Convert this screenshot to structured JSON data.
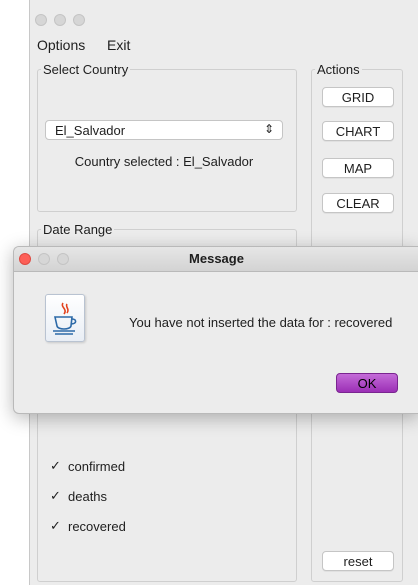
{
  "menu": {
    "options": "Options",
    "exit": "Exit"
  },
  "country_group": {
    "legend": "Select Country",
    "combo_value": "El_Salvador",
    "selected_label": "Country selected : El_Salvador"
  },
  "actions_group": {
    "legend": "Actions",
    "grid": "GRID",
    "chart": "CHART",
    "map": "MAP",
    "clear": "CLEAR",
    "reset": "reset"
  },
  "date_group": {
    "legend": "Date Range"
  },
  "checks": [
    {
      "label": "confirmed",
      "checked": true
    },
    {
      "label": "deaths",
      "checked": true
    },
    {
      "label": "recovered",
      "checked": true
    }
  ],
  "dialog": {
    "title": "Message",
    "message": "You have not inserted the data for : recovered",
    "ok": "OK"
  },
  "colors": {
    "ok_button": "#a23cbb",
    "close_light": "#fd5f57",
    "window_bg": "#ececec"
  },
  "icons": {
    "combo": "chevron-up-down-icon",
    "dialog": "java-coffee-cup-icon",
    "check": "checkmark-icon"
  }
}
